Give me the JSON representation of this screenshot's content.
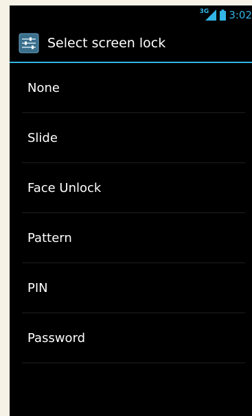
{
  "status_bar": {
    "network_type": "3G",
    "time": "3:02",
    "icons": [
      "signal-icon",
      "battery-icon"
    ],
    "accent_color": "#33b5e5"
  },
  "action_bar": {
    "title": "Select screen lock",
    "icon": "settings-icon"
  },
  "options": [
    {
      "label": "None"
    },
    {
      "label": "Slide"
    },
    {
      "label": "Face Unlock"
    },
    {
      "label": "Pattern"
    },
    {
      "label": "PIN"
    },
    {
      "label": "Password"
    }
  ]
}
